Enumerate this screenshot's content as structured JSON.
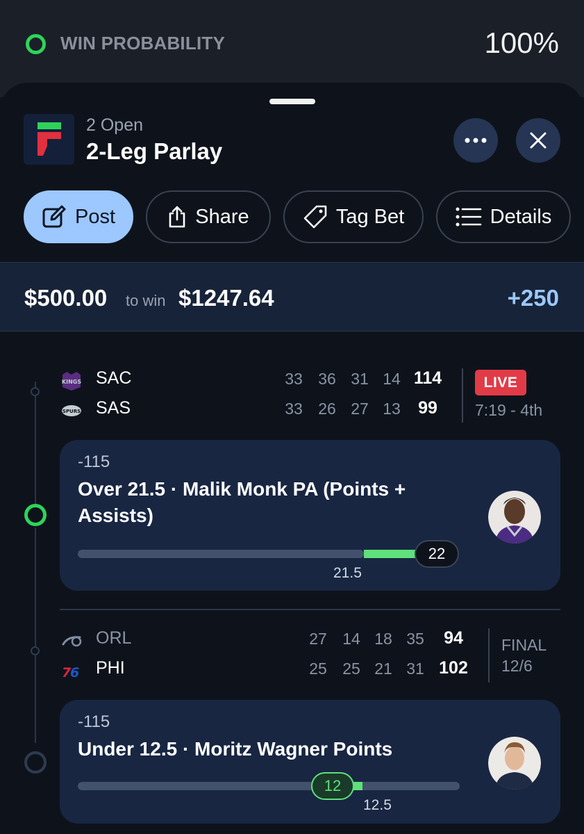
{
  "win_probability": {
    "label": "WIN PROBABILITY",
    "value": "100%",
    "fraction": 1.0,
    "indicator_color": "#2fd35a"
  },
  "header": {
    "subtitle": "2 Open",
    "title": "2-Leg Parlay"
  },
  "actions": {
    "post": "Post",
    "share": "Share",
    "tag_bet": "Tag Bet",
    "details": "Details"
  },
  "stake": {
    "amount": "$500.00",
    "to_win_label": "to win",
    "payout": "$1247.64",
    "odds": "+250"
  },
  "games": [
    {
      "teams": [
        {
          "abbr": "SAC",
          "quarters": [
            "33",
            "36",
            "31",
            "14"
          ],
          "total": "114",
          "logo": "kings-logo"
        },
        {
          "abbr": "SAS",
          "quarters": [
            "33",
            "26",
            "27",
            "13"
          ],
          "total": "99",
          "logo": "spurs-logo"
        }
      ],
      "status_badge": "LIVE",
      "status_text": "7:19 - 4th",
      "leg": {
        "odds": "-115",
        "title_line1": "Over 21.5 · Malik Monk PA (Points +",
        "title_line2": "Assists)",
        "current_value": "22",
        "line_value": "21.5",
        "result": "winning",
        "accent": "#5fe07a"
      }
    },
    {
      "teams": [
        {
          "abbr": "ORL",
          "quarters": [
            "27",
            "14",
            "18",
            "35"
          ],
          "total": "94",
          "logo": "magic-logo"
        },
        {
          "abbr": "PHI",
          "quarters": [
            "25",
            "25",
            "21",
            "31"
          ],
          "total": "102",
          "logo": "76ers-logo"
        }
      ],
      "status_line1": "FINAL",
      "status_line2": "12/6",
      "leg": {
        "odds": "-115",
        "title": "Under 12.5 · Moritz Wagner Points",
        "current_value": "12",
        "line_value": "12.5",
        "result": "winning",
        "accent": "#5fe07a"
      }
    }
  ],
  "colors": {
    "background": "#0e131b",
    "card": "#182642",
    "accent_blue": "#9cc8ff",
    "live_red": "#e23b48",
    "green": "#2fd35a"
  }
}
